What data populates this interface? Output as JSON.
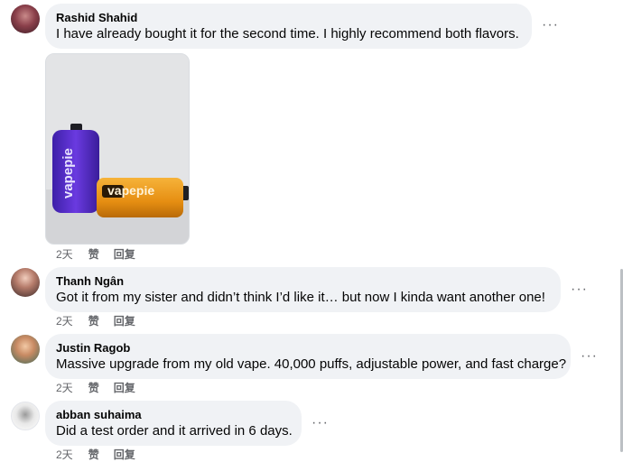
{
  "comments": [
    {
      "author": "Rashid Shahid",
      "text": "I have already bought it for the second time. I highly recommend both flavors.",
      "time": "2天",
      "like_label": "赞",
      "reply_label": "回复",
      "has_photo": true,
      "photo": {
        "brand_purple": "vapepie",
        "brand_orange": "vapepie"
      }
    },
    {
      "author": "Thanh Ngân",
      "text": "Got it from my sister and didn’t think I’d like it… but now I kinda want another one!",
      "time": "2天",
      "like_label": "赞",
      "reply_label": "回复"
    },
    {
      "author": "Justin Ragob",
      "text": "Massive upgrade from my old vape. 40,000 puffs, adjustable power, and fast charge?",
      "time": "2天",
      "like_label": "赞",
      "reply_label": "回复"
    },
    {
      "author": "abban suhaima",
      "text": "Did a test order and it arrived in 6 days.",
      "time": "2天",
      "like_label": "赞",
      "reply_label": "回复"
    }
  ],
  "more_icon": "more-horizontal-icon",
  "colors": {
    "bubble": "#f0f2f5",
    "meta": "#65676b",
    "text": "#050505"
  }
}
